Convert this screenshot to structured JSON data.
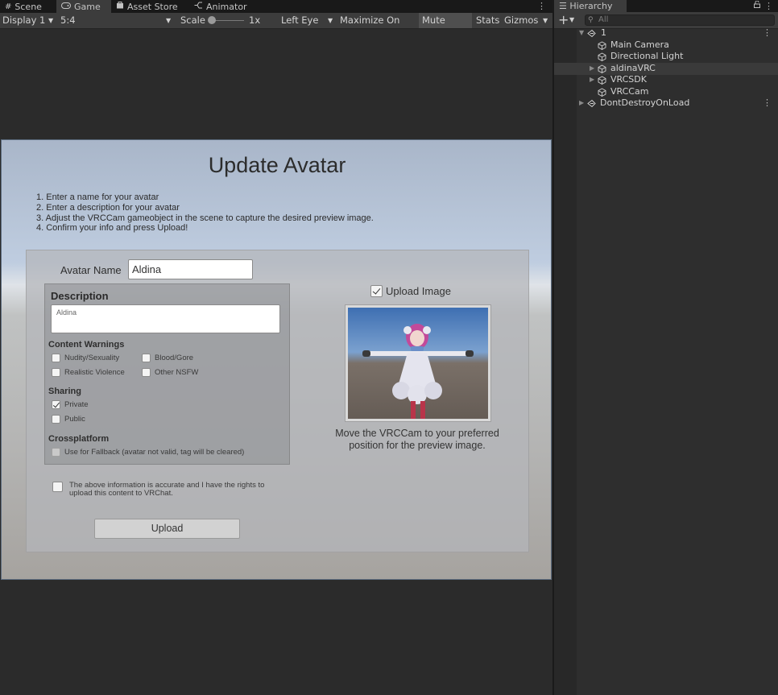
{
  "game_tabs": [
    {
      "label": "Scene",
      "icon": "grid-icon"
    },
    {
      "label": "Game",
      "icon": "gamepad-icon"
    },
    {
      "label": "Asset Store",
      "icon": "bag-icon"
    },
    {
      "label": "Animator",
      "icon": "animator-icon"
    }
  ],
  "toolbar": {
    "display": "Display 1",
    "aspect": "5:4",
    "scale_label": "Scale",
    "scale_value": "1x",
    "eye": "Left Eye",
    "maximize": "Maximize On Play",
    "mute": "Mute Audio",
    "stats": "Stats",
    "gizmos": "Gizmos"
  },
  "form": {
    "title": "Update Avatar",
    "instructions": [
      "1. Enter a name for your avatar",
      "2. Enter a description for your avatar",
      "3. Adjust the VRCCam gameobject in the scene to capture the desired preview image.",
      "4. Confirm your info and press Upload!"
    ],
    "name_label": "Avatar Name",
    "name_value": "Aldina",
    "description_title": "Description",
    "description_value": "Aldina",
    "content_warnings_title": "Content Warnings",
    "warnings": [
      {
        "label": "Nudity/Sexuality",
        "checked": false
      },
      {
        "label": "Blood/Gore",
        "checked": false
      },
      {
        "label": "Realistic Violence",
        "checked": false
      },
      {
        "label": "Other NSFW",
        "checked": false
      }
    ],
    "sharing_title": "Sharing",
    "sharing": [
      {
        "label": "Private",
        "checked": true
      },
      {
        "label": "Public",
        "checked": false
      }
    ],
    "crossplatform_title": "Crossplatform",
    "fallback_label": "Use for Fallback (avatar not valid, tag will be cleared)",
    "legal_line1": "The above information is accurate and I have the rights to",
    "legal_line2": "upload this content to VRChat.",
    "upload_button": "Upload",
    "upload_image_label": "Upload Image",
    "preview_caption_line1": "Move the VRCCam to your preferred",
    "preview_caption_line2": "position for the preview image."
  },
  "hierarchy": {
    "tab_label": "Hierarchy",
    "search_placeholder": "All",
    "items": [
      {
        "label": "1",
        "type": "scene",
        "depth": 0,
        "expanded": true
      },
      {
        "label": "Main Camera",
        "type": "object",
        "depth": 1
      },
      {
        "label": "Directional Light",
        "type": "object",
        "depth": 1
      },
      {
        "label": "aldinaVRC",
        "type": "object",
        "depth": 1,
        "collapsed": true
      },
      {
        "label": "VRCSDK",
        "type": "object",
        "depth": 1,
        "collapsed": true
      },
      {
        "label": "VRCCam",
        "type": "object",
        "depth": 1
      },
      {
        "label": "DontDestroyOnLoad",
        "type": "scene",
        "depth": 0,
        "collapsed": true
      }
    ]
  },
  "colors": {
    "editor_bg": "#282828",
    "panel_bg": "#3c3c3c",
    "text": "#c4c4c4"
  }
}
